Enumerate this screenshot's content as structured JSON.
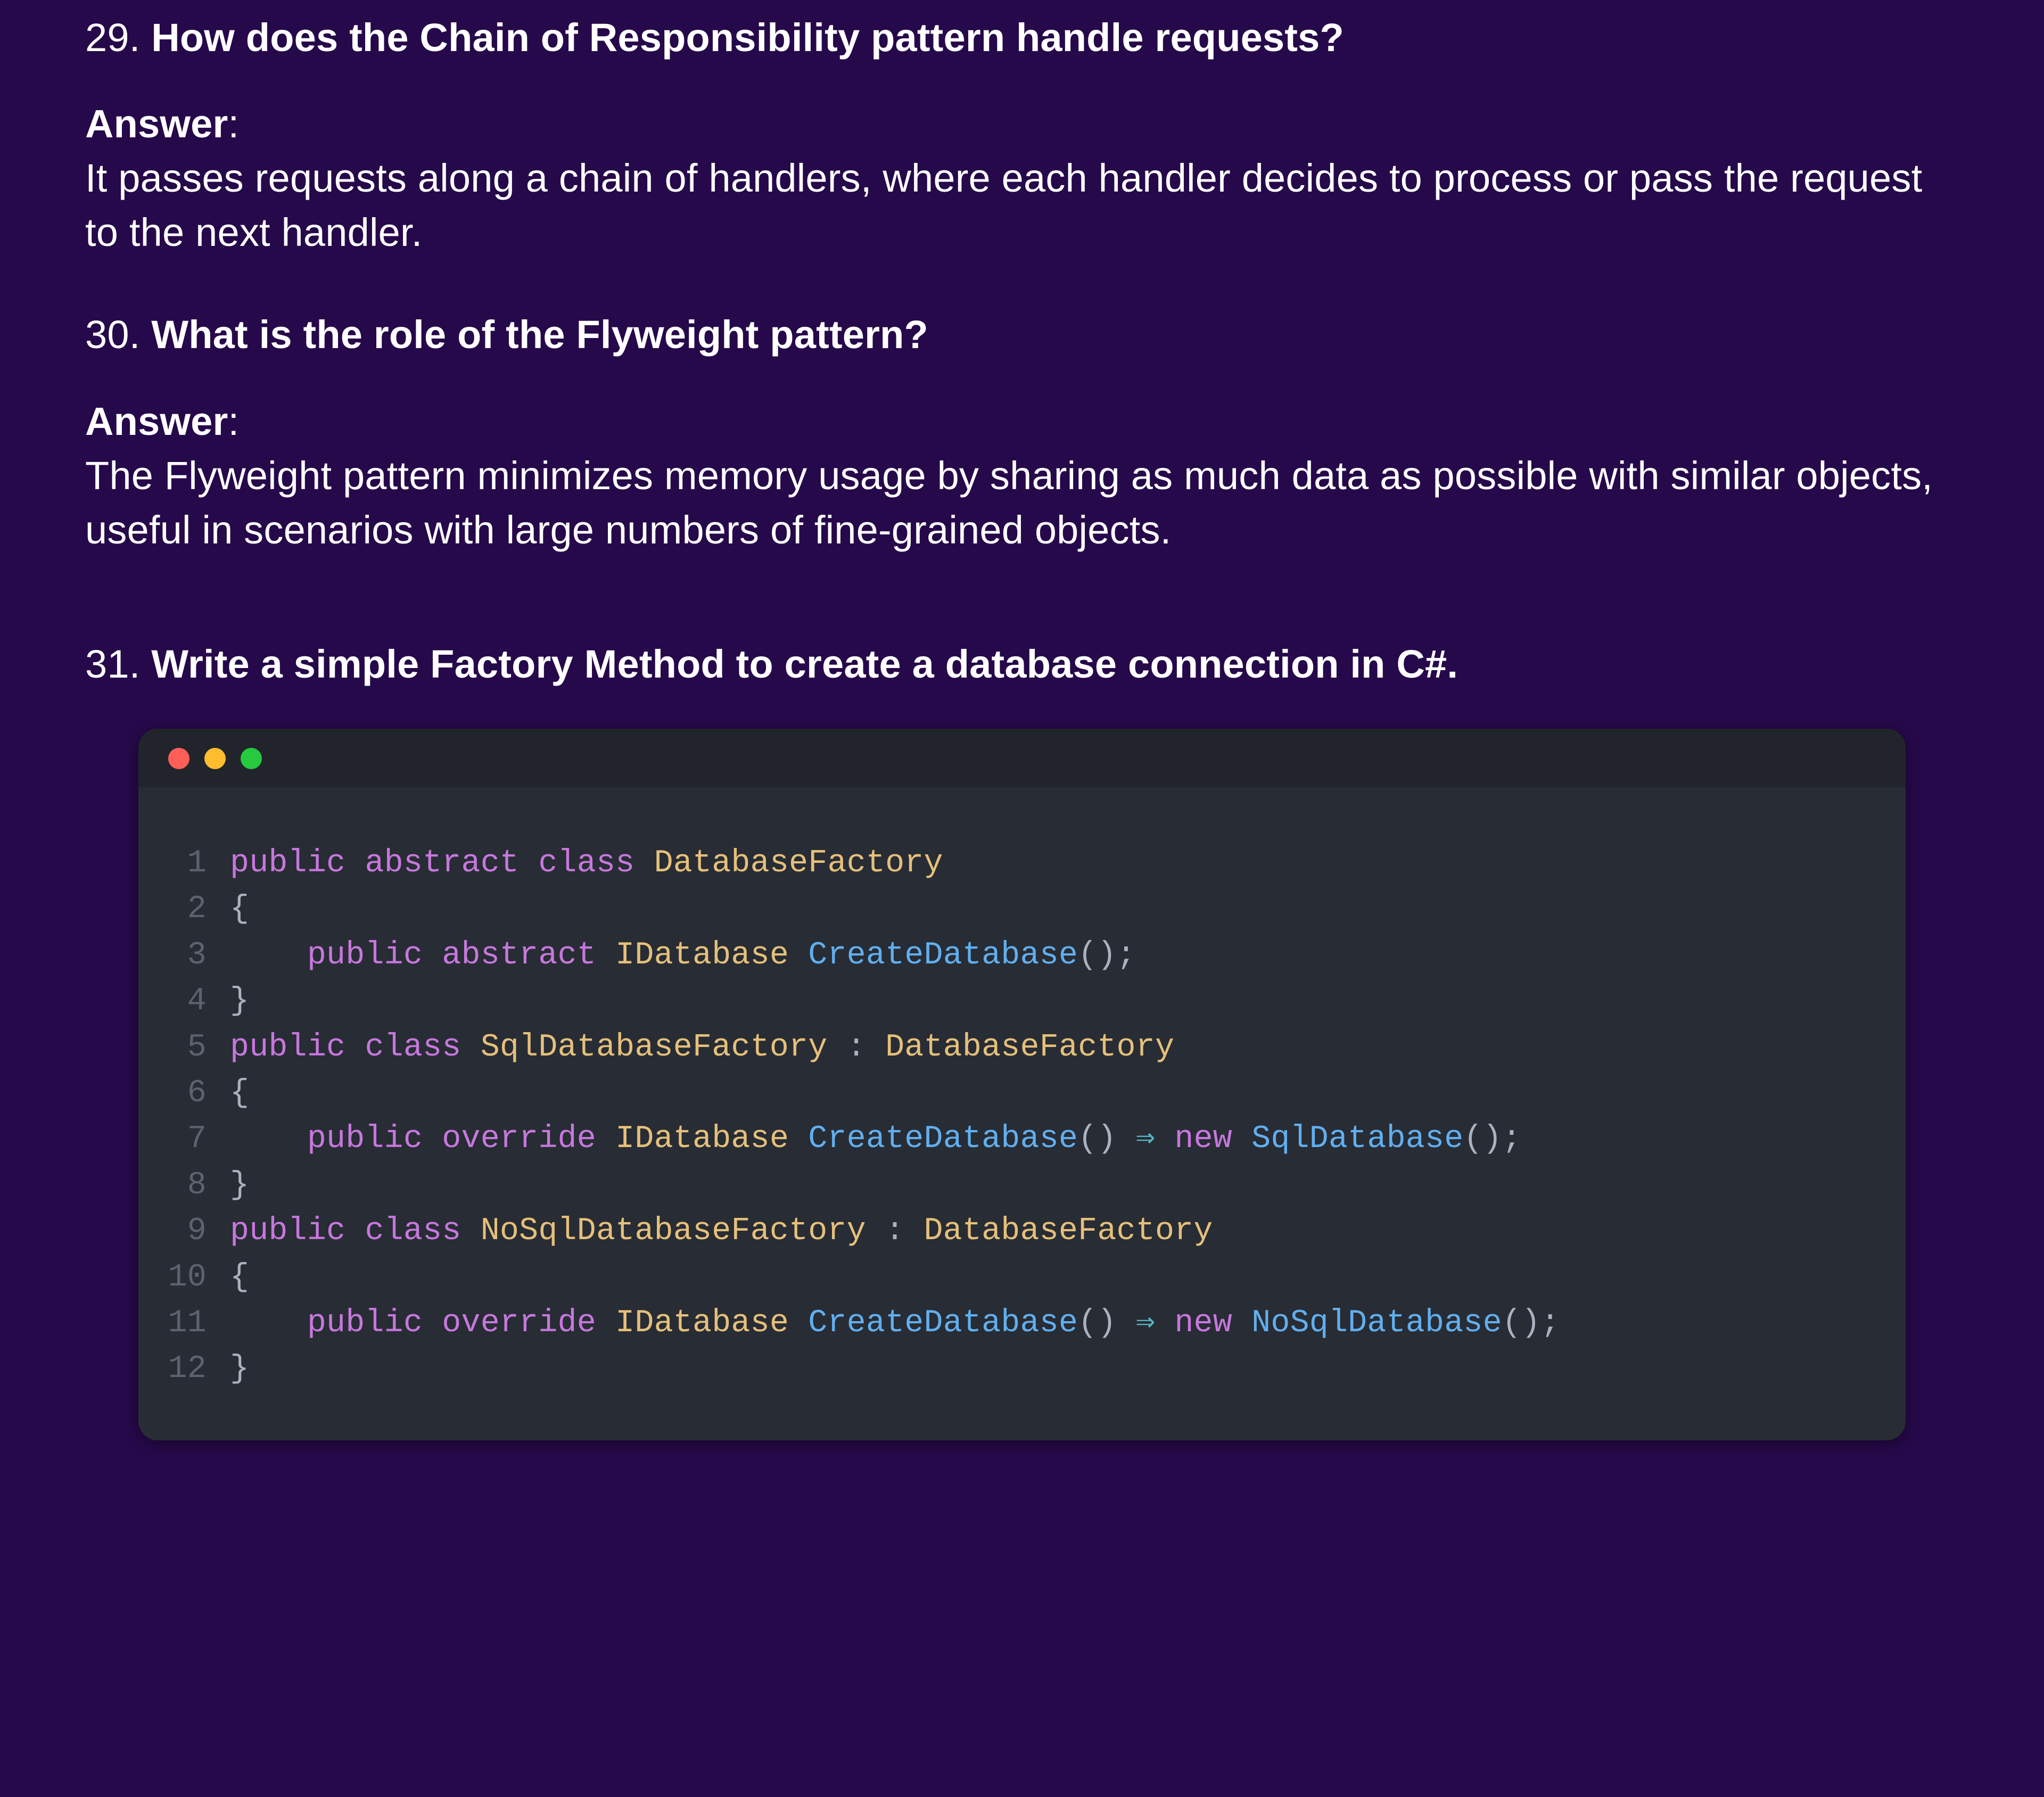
{
  "q29": {
    "num": "29. ",
    "title": "How does the Chain of Responsibility pattern handle requests?",
    "answer_label": "Answer",
    "answer_colon": ":",
    "answer": "It passes requests along a chain of handlers, where each handler decides to process or pass the request to the next handler."
  },
  "q30": {
    "num": "30. ",
    "title": "What is the role of the Flyweight pattern?",
    "answer_label": "Answer",
    "answer_colon": ":",
    "answer": "The Flyweight pattern minimizes memory usage by sharing as much data as possible with similar objects, useful in scenarios with large numbers of fine-grained objects."
  },
  "q31": {
    "num": "31. ",
    "title": "Write a simple Factory Method to create a database connection in C#."
  },
  "code": {
    "lines": [
      {
        "n": "1",
        "tokens": [
          [
            "kw",
            "public"
          ],
          [
            "pn",
            " "
          ],
          [
            "kw",
            "abstract"
          ],
          [
            "pn",
            " "
          ],
          [
            "kw",
            "class"
          ],
          [
            "pn",
            " "
          ],
          [
            "ty",
            "DatabaseFactory"
          ]
        ]
      },
      {
        "n": "2",
        "tokens": [
          [
            "br",
            "{"
          ]
        ]
      },
      {
        "n": "3",
        "tokens": [
          [
            "pn",
            "    "
          ],
          [
            "kw",
            "public"
          ],
          [
            "pn",
            " "
          ],
          [
            "kw",
            "abstract"
          ],
          [
            "pn",
            " "
          ],
          [
            "ret",
            "IDatabase"
          ],
          [
            "pn",
            " "
          ],
          [
            "fn",
            "CreateDatabase"
          ],
          [
            "pn",
            "();"
          ]
        ]
      },
      {
        "n": "4",
        "tokens": [
          [
            "br",
            "}"
          ]
        ]
      },
      {
        "n": "5",
        "tokens": [
          [
            "kw",
            "public"
          ],
          [
            "pn",
            " "
          ],
          [
            "kw",
            "class"
          ],
          [
            "pn",
            " "
          ],
          [
            "ty",
            "SqlDatabaseFactory"
          ],
          [
            "pn",
            " : "
          ],
          [
            "ty",
            "DatabaseFactory"
          ]
        ]
      },
      {
        "n": "6",
        "tokens": [
          [
            "br",
            "{"
          ]
        ]
      },
      {
        "n": "7",
        "tokens": [
          [
            "pn",
            "    "
          ],
          [
            "kw",
            "public"
          ],
          [
            "pn",
            " "
          ],
          [
            "kw",
            "override"
          ],
          [
            "pn",
            " "
          ],
          [
            "ret",
            "IDatabase"
          ],
          [
            "pn",
            " "
          ],
          [
            "fn",
            "CreateDatabase"
          ],
          [
            "pn",
            "() "
          ],
          [
            "op",
            "⇒"
          ],
          [
            "pn",
            " "
          ],
          [
            "kw",
            "new"
          ],
          [
            "pn",
            " "
          ],
          [
            "fn",
            "SqlDatabase"
          ],
          [
            "pn",
            "();"
          ]
        ]
      },
      {
        "n": "8",
        "tokens": [
          [
            "br",
            "}"
          ]
        ]
      },
      {
        "n": "9",
        "tokens": [
          [
            "kw",
            "public"
          ],
          [
            "pn",
            " "
          ],
          [
            "kw",
            "class"
          ],
          [
            "pn",
            " "
          ],
          [
            "ty",
            "NoSqlDatabaseFactory"
          ],
          [
            "pn",
            " : "
          ],
          [
            "ty",
            "DatabaseFactory"
          ]
        ]
      },
      {
        "n": "10",
        "tokens": [
          [
            "br",
            "{"
          ]
        ]
      },
      {
        "n": "11",
        "tokens": [
          [
            "pn",
            "    "
          ],
          [
            "kw",
            "public"
          ],
          [
            "pn",
            " "
          ],
          [
            "kw",
            "override"
          ],
          [
            "pn",
            " "
          ],
          [
            "ret",
            "IDatabase"
          ],
          [
            "pn",
            " "
          ],
          [
            "fn",
            "CreateDatabase"
          ],
          [
            "pn",
            "() "
          ],
          [
            "op",
            "⇒"
          ],
          [
            "pn",
            " "
          ],
          [
            "kw",
            "new"
          ],
          [
            "pn",
            " "
          ],
          [
            "fn",
            "NoSqlDatabase"
          ],
          [
            "pn",
            "();"
          ]
        ]
      },
      {
        "n": "12",
        "tokens": [
          [
            "br",
            "}"
          ]
        ]
      }
    ]
  }
}
